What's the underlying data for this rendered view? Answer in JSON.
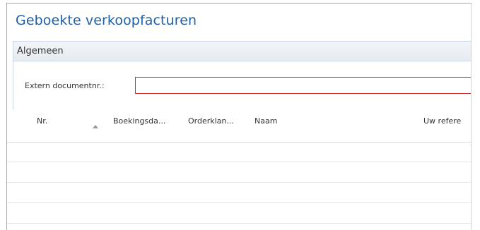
{
  "page": {
    "title": "Geboekte verkoopfacturen"
  },
  "fasttab": {
    "title": "Algemeen",
    "fields": [
      {
        "label": "Extern documentnr.:",
        "value": ""
      }
    ]
  },
  "grid": {
    "columns": [
      {
        "label": "Nr."
      },
      {
        "label": "Boekingsda..."
      },
      {
        "label": "Orderklan..."
      },
      {
        "label": "Naam"
      },
      {
        "label": "Uw refere"
      }
    ],
    "sort": {
      "column": "Nr.",
      "direction": "ascending"
    },
    "rows": []
  },
  "colors": {
    "title": "#1e5fa8",
    "required_border": "#cc2e2e",
    "fasttab_border": "#c9d7e8"
  }
}
